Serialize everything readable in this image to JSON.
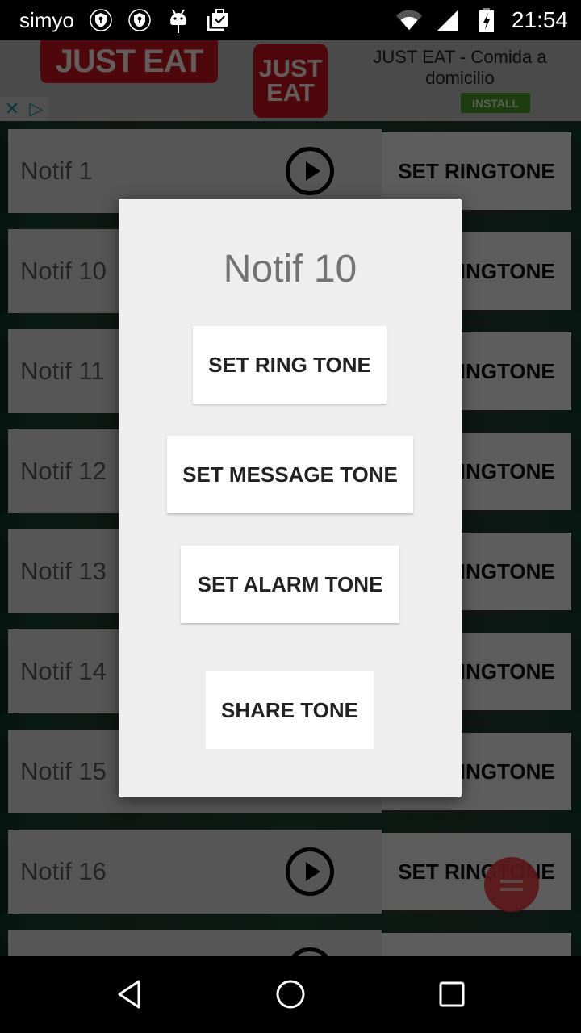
{
  "status_bar": {
    "carrier": "simyo",
    "time": "21:54",
    "icons": [
      "vpn-shield-icon",
      "vpn-shield-icon",
      "android-icon",
      "clipboard-check-icon",
      "wifi-icon",
      "signal-icon",
      "battery-charging-icon"
    ]
  },
  "ad": {
    "brand_wide": "JUST EAT",
    "brand_square_line1": "JUST",
    "brand_square_line2": "EAT",
    "title": "JUST EAT - Comida a domicilio",
    "install_label": "INSTALL",
    "close_glyph": "✕",
    "adchoices_glyph": "▷",
    "colors": {
      "brand": "#c4161c",
      "install": "#4a9a2a"
    }
  },
  "list": {
    "button_label": "SET RINGTONE",
    "rows": [
      {
        "name": "Notif 1"
      },
      {
        "name": "Notif 10"
      },
      {
        "name": "Notif 11"
      },
      {
        "name": "Notif 12"
      },
      {
        "name": "Notif 13"
      },
      {
        "name": "Notif 14"
      },
      {
        "name": "Notif 15"
      },
      {
        "name": "Notif 16"
      },
      {
        "name": ""
      }
    ]
  },
  "dialog": {
    "title": "Notif 10",
    "buttons": {
      "ring": "SET RING TONE",
      "message": "SET MESSAGE TONE",
      "alarm": "SET ALARM TONE",
      "share": "SHARE TONE"
    }
  },
  "nav_bar": {
    "back": "back-icon",
    "home": "home-icon",
    "recents": "recents-icon"
  }
}
